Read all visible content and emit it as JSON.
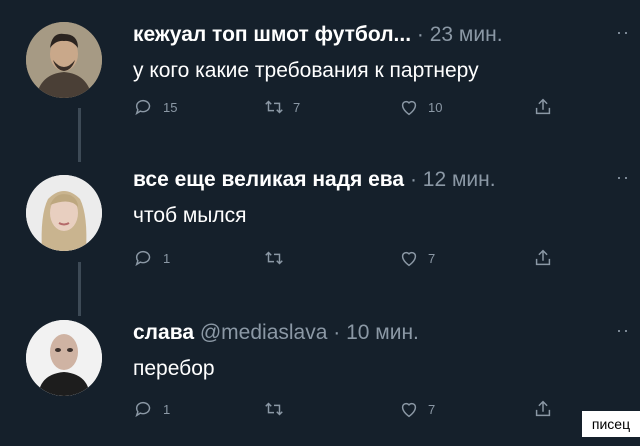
{
  "tweets": [
    {
      "name": "кежуал топ шмот футбол...",
      "handle": "",
      "separator": "·",
      "time": "23 мин.",
      "text": "у кого какие требования к партнеру",
      "counts": {
        "reply": "15",
        "retweet": "7",
        "like": "10"
      }
    },
    {
      "name": "все еще великая надя ева",
      "handle": "",
      "separator": "·",
      "time": "12 мин.",
      "text": "чтоб мылся",
      "counts": {
        "reply": "1",
        "retweet": "",
        "like": "7"
      }
    },
    {
      "name": "слава",
      "handle": "@mediaslava",
      "separator": "·",
      "time": "10 мин.",
      "text": "перебор",
      "counts": {
        "reply": "1",
        "retweet": "",
        "like": "7"
      }
    }
  ],
  "more_label": "··",
  "watermark": "писец",
  "colors": {
    "background": "#15202b",
    "muted": "#8b98a5",
    "thread": "#3d4a56"
  },
  "icons": {
    "reply": "reply-icon",
    "retweet": "retweet-icon",
    "like": "like-icon",
    "share": "share-icon"
  }
}
